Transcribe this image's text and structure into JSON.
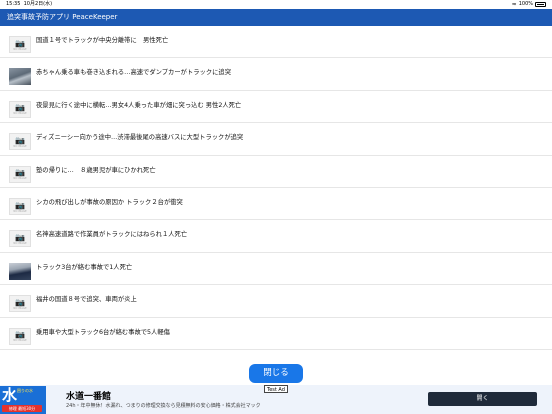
{
  "status_bar": {
    "time": "15:35",
    "date": "10月2日(水)",
    "battery": "100%"
  },
  "header": {
    "title": "追突事故予防アプリ PeaceKeeper"
  },
  "list": {
    "no_image_label": "NO IMAGE",
    "items": [
      {
        "title": "国道１号でトラックが中央分離帯に　男性死亡",
        "thumb": "no-image"
      },
      {
        "title": "赤ちゃん乗る車も巻き込まれる…高速でダンプカーがトラックに追突",
        "thumb": "photo"
      },
      {
        "title": "夜景見に行く途中に横転…男女4人乗った車が畑に突っ込む 男性2人死亡",
        "thumb": "no-image"
      },
      {
        "title": "ディズニーシー向かう途中…渋滞最後尾の高速バスに大型トラックが追突",
        "thumb": "no-image"
      },
      {
        "title": "塾の帰りに…　８歳男児が車にひかれ死亡",
        "thumb": "no-image"
      },
      {
        "title": "シカの飛び出しが事故の原因か トラック２台が衝突",
        "thumb": "no-image"
      },
      {
        "title": "名神高速道路で作業員がトラックにはねられ１人死亡",
        "thumb": "no-image"
      },
      {
        "title": "トラック3台が絡む事故で1人死亡",
        "thumb": "photo"
      },
      {
        "title": "福井の国道８号で追突、車両が炎上",
        "thumb": "no-image"
      },
      {
        "title": "乗用車や大型トラック6台が絡む事故で5人軽傷",
        "thumb": "no-image"
      }
    ]
  },
  "close_button": {
    "label": "閉じる"
  },
  "ad": {
    "label": "Test Ad",
    "logo_text": "水",
    "logo_small": "困りの水",
    "logo_badge": "修理 最短30分",
    "title": "水道一番館",
    "description": "24h・年中無休！水漏れ、つまりの修理交換なら見積無料の安心価格・株式会社マック",
    "open_label": "開く"
  },
  "colors": {
    "header_bg": "#1d59b3",
    "close_button_bg": "#1977e8",
    "ad_button_bg": "#1f2a3a"
  }
}
